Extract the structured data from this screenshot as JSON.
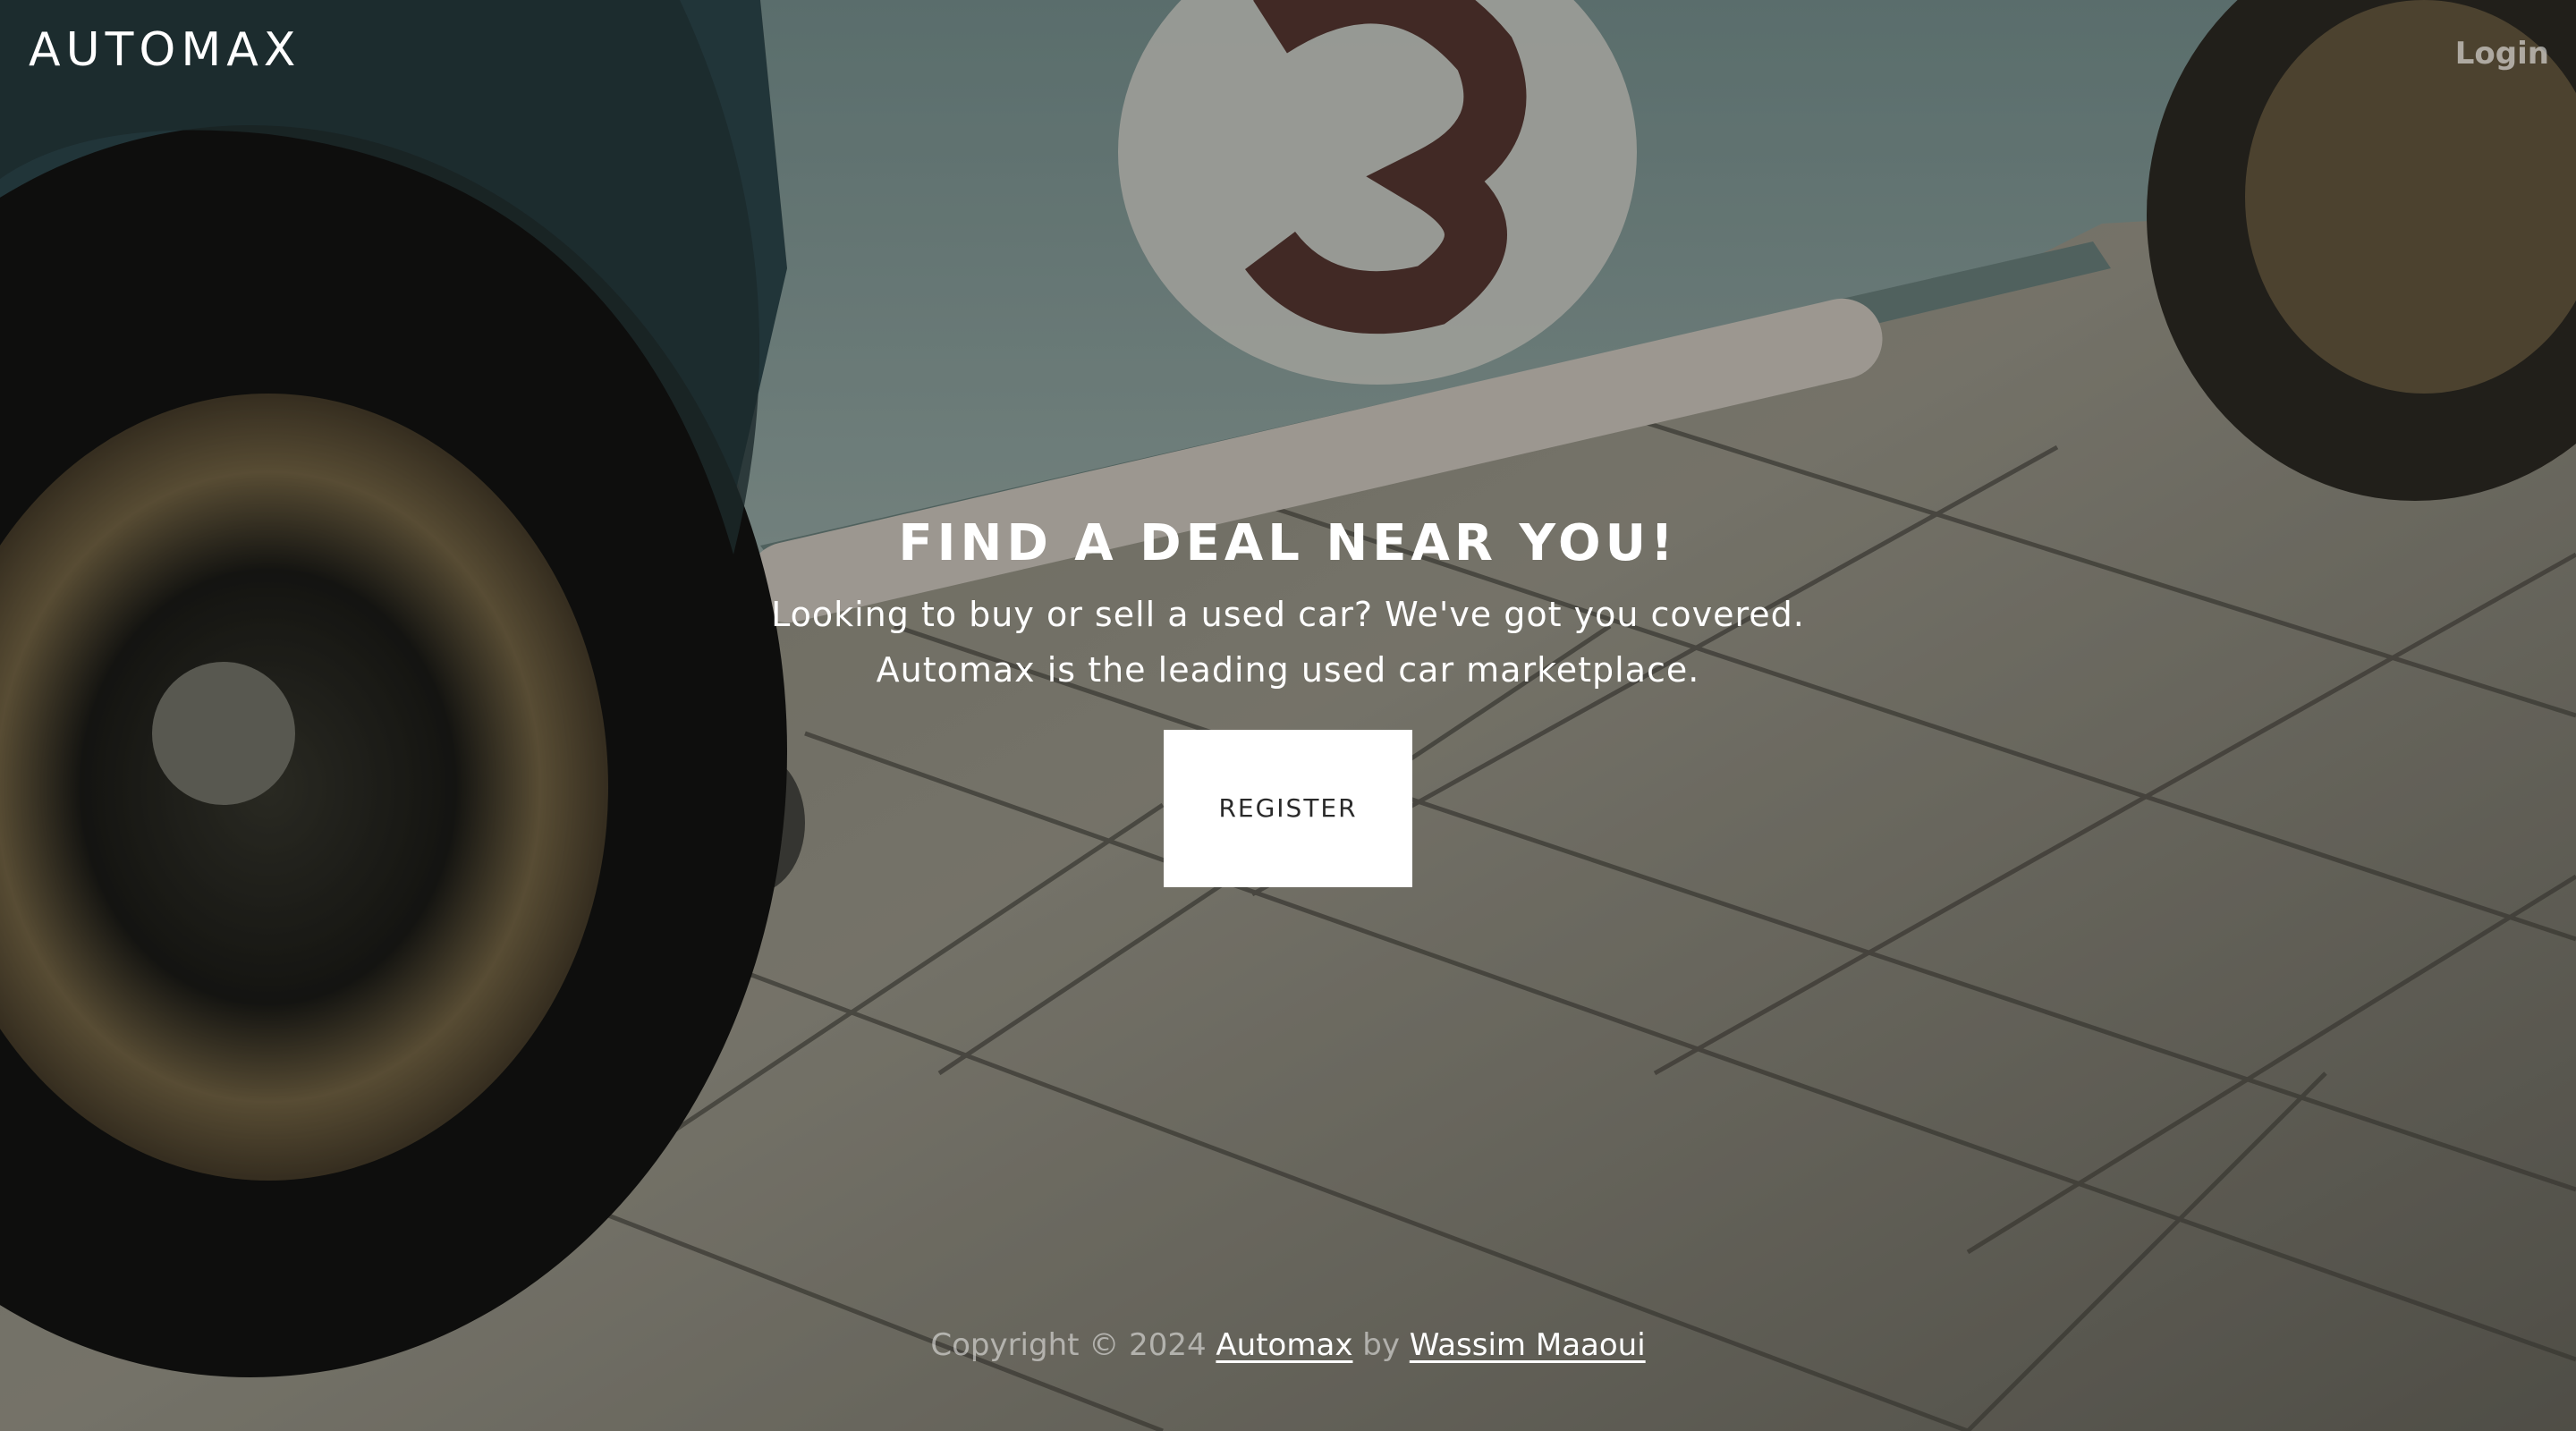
{
  "header": {
    "brand": "AUTOMAX",
    "login_label": "Login"
  },
  "hero": {
    "title": "FIND A DEAL NEAR YOU!",
    "lead_line1": "Looking to buy or sell a used car? We've got you covered.",
    "lead_line2": "Automax is the leading used car marketplace.",
    "register_label": "REGISTER"
  },
  "footer": {
    "copyright_prefix": "Copyright © 2024",
    "brand_link": "Automax",
    "by_text": "by",
    "author_link": "Wassim Maaoui"
  },
  "colors": {
    "text": "#ffffff",
    "button_bg": "#ffffff",
    "button_text": "#2a2a2a",
    "overlay": "rgba(0,0,0,0.28)"
  }
}
